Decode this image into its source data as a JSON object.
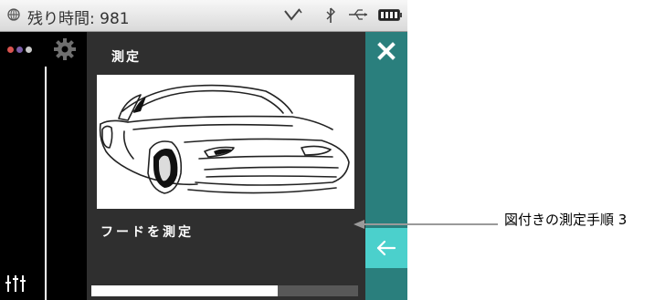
{
  "status_bar": {
    "remaining_time": "残り時間: 981",
    "icons": [
      "globe-icon",
      "signal-check-icon",
      "bluetooth-icon",
      "usb-icon",
      "battery-icon"
    ]
  },
  "sidebar": {
    "icons": [
      "color-dots-icon",
      "gear-icon",
      "slider-settings-icon"
    ],
    "dot_colors": [
      "#d9534f",
      "#7b5ea7",
      "#c9c9c9"
    ]
  },
  "main": {
    "title": "測定",
    "illustration": "car-hood-illustration",
    "step_label": "フードを測定",
    "progress_fraction": 0.7
  },
  "right_bar": {
    "close_icon": "close-icon",
    "back_icon": "back-arrow-icon"
  },
  "callout": {
    "text": "図付きの測定手順 3"
  },
  "colors": {
    "accent_teal": "#2a7f7d",
    "accent_light_teal": "#4bd0cc",
    "panel_dark": "#2f2f2f"
  }
}
